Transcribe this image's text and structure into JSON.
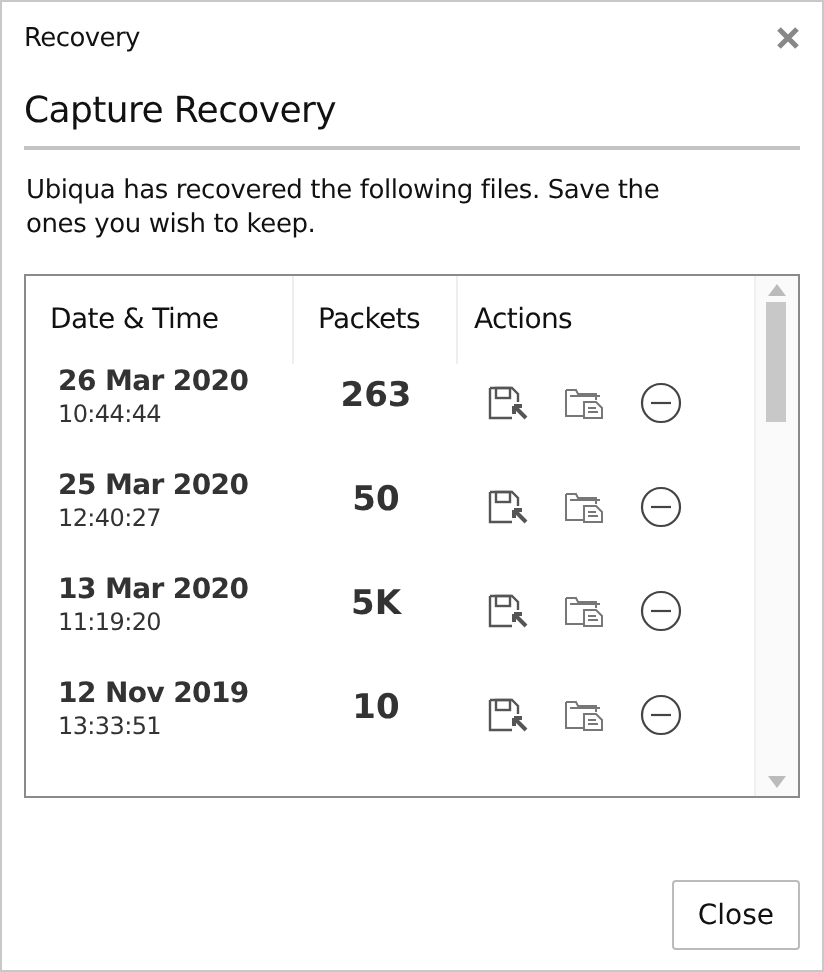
{
  "window": {
    "title": "Recovery"
  },
  "heading": "Capture Recovery",
  "description": "Ubiqua has recovered the following files. Save the ones you wish to keep.",
  "table": {
    "columns": [
      "Date & Time",
      "Packets",
      "Actions"
    ],
    "rows": [
      {
        "date": "26 Mar 2020",
        "time": "10:44:44",
        "packets": "263"
      },
      {
        "date": "25 Mar 2020",
        "time": "12:40:27",
        "packets": "50"
      },
      {
        "date": "13 Mar 2020",
        "time": "11:19:20",
        "packets": "5K"
      },
      {
        "date": "12 Nov 2019",
        "time": "13:33:51",
        "packets": "10"
      }
    ]
  },
  "buttons": [
    "Close"
  ]
}
